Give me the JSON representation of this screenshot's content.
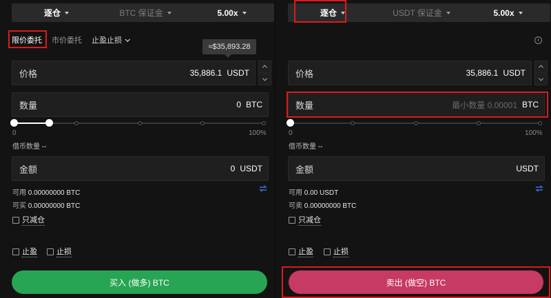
{
  "left": {
    "top_bar": {
      "margin_mode": "逐仓",
      "collateral": "BTC 保证金",
      "leverage": "5.00x"
    },
    "tabs": [
      {
        "label": "限价委托"
      },
      {
        "label": "市价委托"
      },
      {
        "label": "止盈止损"
      }
    ],
    "tooltip": "≈$35,893.28",
    "price": {
      "label": "价格",
      "value": "35,886.1",
      "unit": "USDT"
    },
    "quantity": {
      "label": "数量",
      "value": "0",
      "unit": "BTC"
    },
    "slider": {
      "min_label": "0",
      "max_label": "100%",
      "fill_percent": 14
    },
    "borrow": {
      "label": "借币数量",
      "value": "--"
    },
    "amount": {
      "label": "金额",
      "value": "0",
      "unit": "USDT"
    },
    "available": {
      "label": "可用",
      "value": "0.00000000 BTC"
    },
    "buyable": {
      "label": "可买",
      "value": "0.00000000 BTC"
    },
    "reduce_only": "只减仓",
    "take_profit": "止盈",
    "stop_loss": "止损",
    "submit": "买入 (做多) BTC"
  },
  "right": {
    "top_bar": {
      "margin_mode": "逐仓",
      "collateral": "USDT 保证金",
      "leverage": "5.00x"
    },
    "price": {
      "label": "价格",
      "value": "35,886.1",
      "unit": "USDT"
    },
    "quantity": {
      "label": "数量",
      "placeholder": "最小数量 0.00001",
      "unit": "BTC"
    },
    "slider": {
      "min_label": "0",
      "max_label": "100%",
      "fill_percent": 0
    },
    "borrow": {
      "label": "借币数量",
      "value": "--"
    },
    "amount": {
      "label": "金额",
      "unit": "USDT"
    },
    "available": {
      "label": "可用",
      "value": "0.00 USDT"
    },
    "sellable": {
      "label": "可卖",
      "value": "0.00000000 BTC"
    },
    "reduce_only": "只减仓",
    "take_profit": "止盈",
    "stop_loss": "止损",
    "submit": "卖出 (做空) BTC"
  },
  "colors": {
    "buy": "#28a554",
    "sell": "#c73a63",
    "highlight": "#e01a1a",
    "swap": "#3a6ee8"
  }
}
